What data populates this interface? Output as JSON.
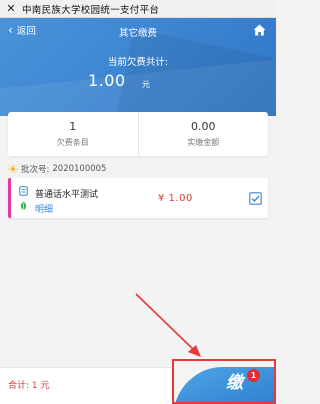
{
  "window": {
    "close_glyph": "✕",
    "title": "中南民族大学校园统一支付平台"
  },
  "nav": {
    "back_label": "返回",
    "title": "其它缴费"
  },
  "summary": {
    "owed_label": "当前欠费共计:",
    "owed_amount": "1.00",
    "owed_unit": "元"
  },
  "stats": [
    {
      "value": "1",
      "label": "欠费条目"
    },
    {
      "value": "0.00",
      "label": "实缴金额"
    }
  ],
  "batch": {
    "label": "批次号:",
    "number": "2020100005"
  },
  "items": [
    {
      "name": "普通话水平测试",
      "detail_label": "明细",
      "price": "¥ 1.00",
      "checked": true
    }
  ],
  "footer": {
    "total": "合计: 1 元",
    "pay_label": "缴",
    "badge_count": "1"
  },
  "colors": {
    "accent_blue": "#2f76c8",
    "price_red": "#e03a3a",
    "item_bar": "#e23aa5",
    "highlight_red": "#e63a3a"
  },
  "icons": [
    "close-icon",
    "back-chevron-icon",
    "home-icon",
    "sun-icon",
    "document-icon",
    "leaf-icon",
    "checkbox-icon",
    "arrow-annotation"
  ]
}
